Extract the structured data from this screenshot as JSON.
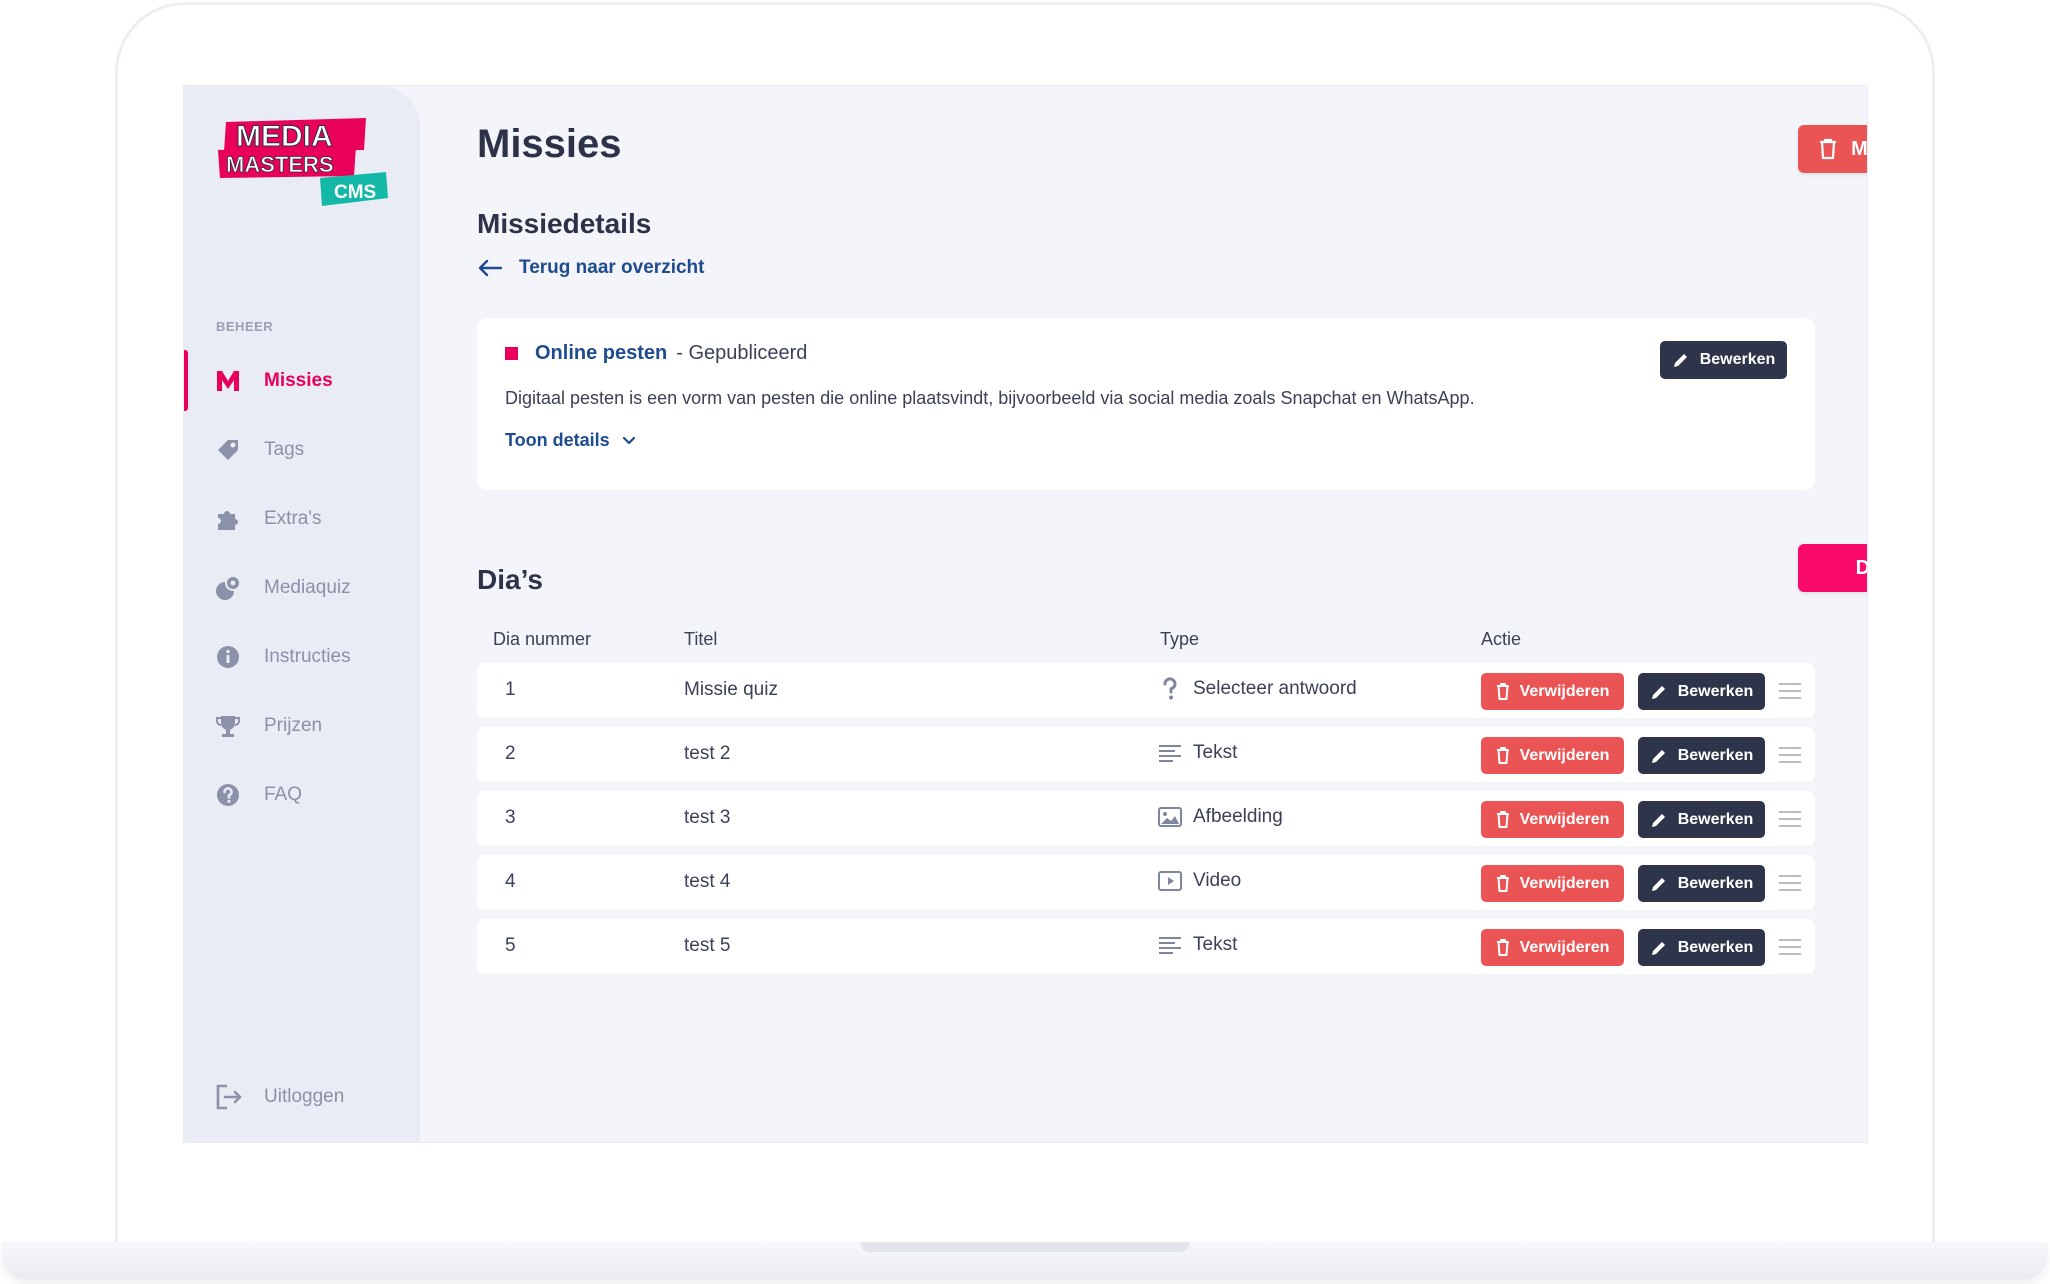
{
  "logo": {
    "line1": "MEDIA",
    "line2": "MASTERS",
    "badge": "CMS"
  },
  "sidebar": {
    "section_label": "BEHEER",
    "items": [
      {
        "label": "Missies",
        "icon": "m-icon",
        "active": true
      },
      {
        "label": "Tags",
        "icon": "tag-icon"
      },
      {
        "label": "Extra's",
        "icon": "puzzle-icon"
      },
      {
        "label": "Mediaquiz",
        "icon": "mediaquiz-icon"
      },
      {
        "label": "Instructies",
        "icon": "info-icon"
      },
      {
        "label": "Prijzen",
        "icon": "trophy-icon"
      },
      {
        "label": "FAQ",
        "icon": "question-icon"
      }
    ],
    "logout_label": "Uitloggen"
  },
  "header": {
    "title": "Missies",
    "delete_mission_label": "Missie verwijderen"
  },
  "details": {
    "section_title": "Missiedetails",
    "back_label": "Terug naar overzicht",
    "mission_name": "Online pesten",
    "mission_status": "- Gepubliceerd",
    "description": "Digitaal pesten is een vorm van pesten die online plaatsvindt, bijvoorbeeld via social media zoals Snapchat en WhatsApp.",
    "toggle_label": "Toon details",
    "edit_label": "Bewerken"
  },
  "slides": {
    "section_title": "Dia’s",
    "add_label": "Dia toevoegen",
    "columns": [
      "Dia nummer",
      "Titel",
      "Type",
      "Actie"
    ],
    "delete_label": "Verwijderen",
    "edit_label": "Bewerken",
    "rows": [
      {
        "number": "1",
        "title": "Missie quiz",
        "type": "Selecteer antwoord",
        "type_icon": "question-mark-icon"
      },
      {
        "number": "2",
        "title": "test 2",
        "type": "Tekst",
        "type_icon": "text-lines-icon"
      },
      {
        "number": "3",
        "title": "test 3",
        "type": "Afbeelding",
        "type_icon": "image-icon"
      },
      {
        "number": "4",
        "title": "test 4",
        "type": "Video",
        "type_icon": "video-icon"
      },
      {
        "number": "5",
        "title": "test 5",
        "type": "Tekst",
        "type_icon": "text-lines-icon"
      }
    ]
  },
  "colors": {
    "accent_pink": "#fa0b6b",
    "danger": "#ea5455",
    "dark": "#2e3449",
    "link_blue": "#1f4b8f"
  }
}
